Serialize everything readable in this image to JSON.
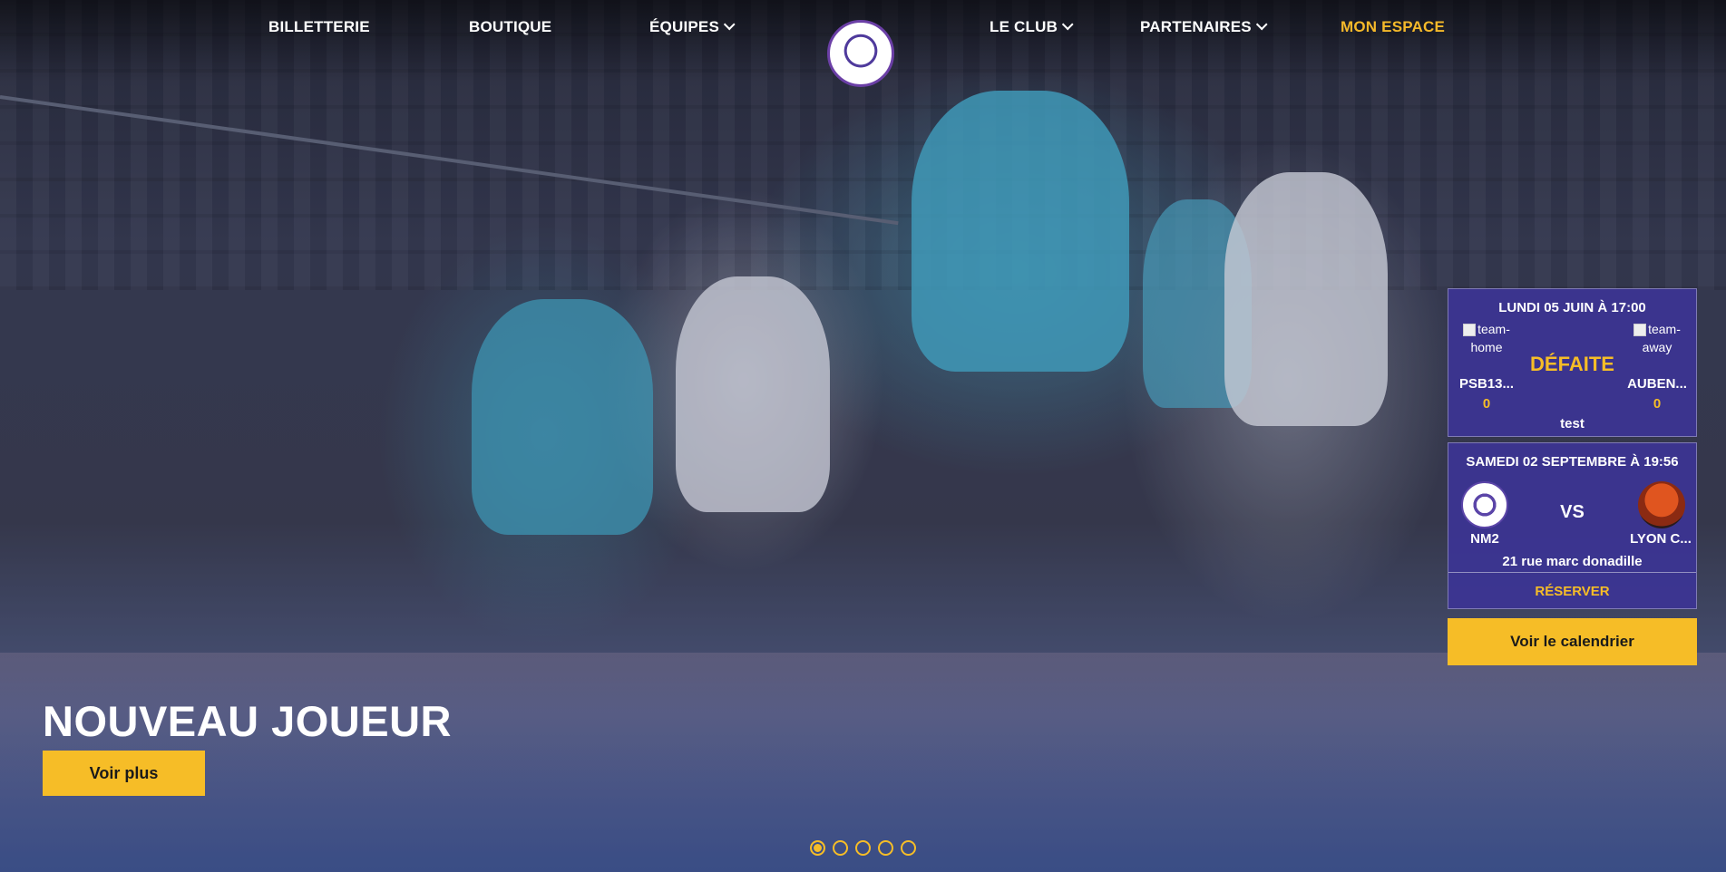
{
  "nav": {
    "billetterie": "BILLETTERIE",
    "boutique": "BOUTIQUE",
    "equipes": "ÉQUIPES",
    "le_club": "LE CLUB",
    "partenaires": "PARTENAIRES",
    "mon_espace": "MON ESPACE"
  },
  "hero": {
    "title": "NOUVEAU JOUEUR",
    "button": "Voir plus",
    "slides": 5,
    "active_slide": 1
  },
  "matches": [
    {
      "date": "LUNDI 05 JUIN À 17:00",
      "home_img_alt": "team-home",
      "away_img_alt": "team-away",
      "home_name": "PSB13...",
      "away_name": "AUBEN...",
      "home_score": "0",
      "away_score": "0",
      "result": "DÉFAITE",
      "note": "test"
    },
    {
      "date": "SAMEDI 02 SEPTEMBRE À 19:56",
      "home_name": "NM2",
      "away_name": "LYON C...",
      "vs": "VS",
      "address": "21 rue marc donadille",
      "reserve": "RÉSERVER"
    }
  ],
  "calendar_button": "Voir le calendrier",
  "colors": {
    "accent": "#f6bd27",
    "card": "#3c3496",
    "text": "#ffffff"
  }
}
